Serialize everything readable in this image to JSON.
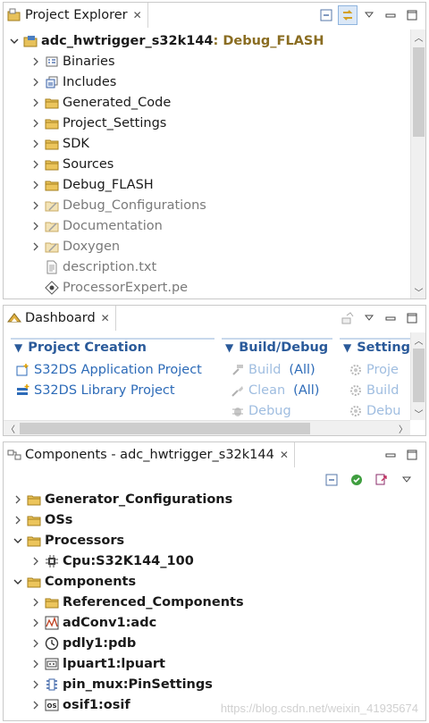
{
  "project_explorer": {
    "tab_label": "Project Explorer",
    "root": {
      "name": "adc_hwtrigger_s32k144",
      "suffix": ": Debug_FLASH"
    },
    "items": [
      {
        "label": "Binaries",
        "icon": "binaries-icon",
        "gray": false,
        "twisty": true
      },
      {
        "label": "Includes",
        "icon": "includes-icon",
        "gray": false,
        "twisty": true
      },
      {
        "label": "Generated_Code",
        "icon": "folder-icon",
        "gray": false,
        "twisty": true
      },
      {
        "label": "Project_Settings",
        "icon": "folder-icon",
        "gray": false,
        "twisty": true
      },
      {
        "label": "SDK",
        "icon": "folder-icon",
        "gray": false,
        "twisty": true
      },
      {
        "label": "Sources",
        "icon": "folder-icon",
        "gray": false,
        "twisty": true
      },
      {
        "label": "Debug_FLASH",
        "icon": "folder-icon",
        "gray": false,
        "twisty": true
      },
      {
        "label": "Debug_Configurations",
        "icon": "folder-excluded-icon",
        "gray": true,
        "twisty": true
      },
      {
        "label": "Documentation",
        "icon": "folder-excluded-icon",
        "gray": true,
        "twisty": true
      },
      {
        "label": "Doxygen",
        "icon": "folder-excluded-icon",
        "gray": true,
        "twisty": true
      },
      {
        "label": "description.txt",
        "icon": "text-file-icon",
        "gray": true,
        "twisty": false
      },
      {
        "label": "ProcessorExpert.pe",
        "icon": "processor-expert-file-icon",
        "gray": true,
        "twisty": false
      }
    ]
  },
  "dashboard": {
    "tab_label": "Dashboard",
    "sections": [
      {
        "title": "Project Creation"
      },
      {
        "title": "Build/Debug"
      },
      {
        "title": "Setting"
      }
    ],
    "creation_links": [
      "S32DS Application Project",
      "S32DS Library Project"
    ],
    "build_links": [
      {
        "label": "Build",
        "extra": "(All)"
      },
      {
        "label": "Clean",
        "extra": "(All)"
      },
      {
        "label": "Debug",
        "extra": ""
      }
    ],
    "settings_links": [
      "Proje",
      "Build",
      "Debu"
    ]
  },
  "components": {
    "tab_label": "Components - adc_hwtrigger_s32k144",
    "items": [
      {
        "label": "Generator_Configurations",
        "level": 0,
        "twisty": "closed",
        "icon": "folder-icon"
      },
      {
        "label": "OSs",
        "level": 0,
        "twisty": "closed",
        "icon": "folder-icon"
      },
      {
        "label": "Processors",
        "level": 0,
        "twisty": "open",
        "icon": "folder-icon"
      },
      {
        "label": "Cpu:S32K144_100",
        "level": 1,
        "twisty": "closed",
        "icon": "cpu-icon"
      },
      {
        "label": "Components",
        "level": 0,
        "twisty": "open",
        "icon": "folder-icon"
      },
      {
        "label": "Referenced_Components",
        "level": 1,
        "twisty": "closed",
        "icon": "folder-icon"
      },
      {
        "label": "adConv1:adc",
        "level": 1,
        "twisty": "closed",
        "icon": "adc-component-icon"
      },
      {
        "label": "pdly1:pdb",
        "level": 1,
        "twisty": "closed",
        "icon": "pdb-component-icon"
      },
      {
        "label": "lpuart1:lpuart",
        "level": 1,
        "twisty": "closed",
        "icon": "lpuart-component-icon"
      },
      {
        "label": "pin_mux:PinSettings",
        "level": 1,
        "twisty": "closed",
        "icon": "pin-settings-icon"
      },
      {
        "label": "osif1:osif",
        "level": 1,
        "twisty": "closed",
        "icon": "osif-component-icon"
      }
    ]
  },
  "watermark": "https://blog.csdn.net/weixin_41935674",
  "colors": {
    "link": "#2d6bb8",
    "section_title": "#2a5a9a",
    "suffix": "#8a6d22",
    "gray_text": "#7a7a7a"
  }
}
